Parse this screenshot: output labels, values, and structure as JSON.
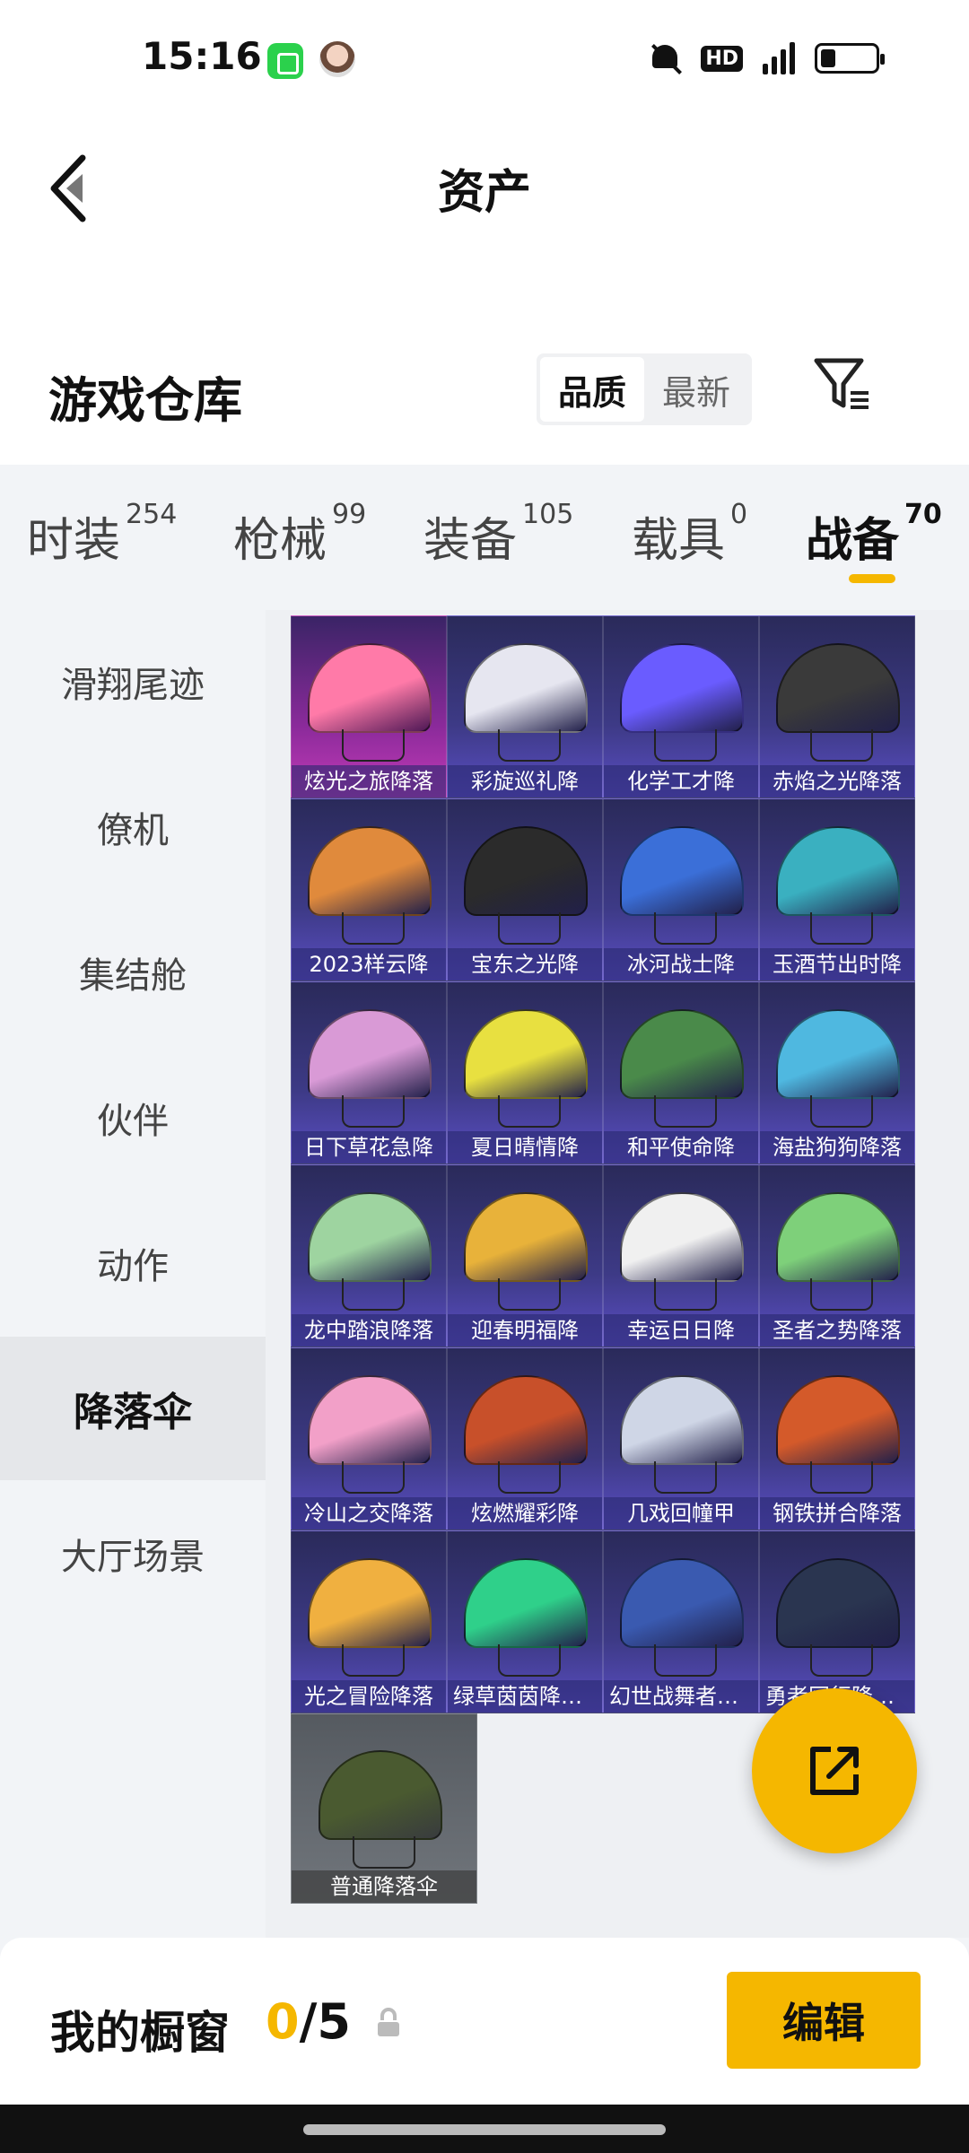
{
  "status": {
    "time": "15:16"
  },
  "nav": {
    "title": "资产"
  },
  "warehouse": {
    "title": "游戏仓库",
    "sort_options": [
      {
        "label": "品质",
        "active": true
      },
      {
        "label": "最新",
        "active": false
      }
    ]
  },
  "category_tabs": [
    {
      "label": "时装",
      "count": "254"
    },
    {
      "label": "枪械",
      "count": "99"
    },
    {
      "label": "装备",
      "count": "105"
    },
    {
      "label": "载具",
      "count": "0"
    },
    {
      "label": "战备",
      "count": "70",
      "active": true
    }
  ],
  "sidebar": [
    {
      "label": "滑翔尾迹"
    },
    {
      "label": "僚机"
    },
    {
      "label": "集结舱"
    },
    {
      "label": "伙伴"
    },
    {
      "label": "动作"
    },
    {
      "label": "降落伞",
      "active": true
    },
    {
      "label": "大厅场景"
    }
  ],
  "items": [
    {
      "name": "炫光之旅降落",
      "color": "#ff7aa8"
    },
    {
      "name": "彩旋巡礼降",
      "color": "#e6e6f0"
    },
    {
      "name": "化学工才降",
      "color": "#6a5cff"
    },
    {
      "name": "赤焰之光降落",
      "color": "#3a3a3a"
    },
    {
      "name": "2023样云降",
      "color": "#e08a3c"
    },
    {
      "name": "宝东之光降",
      "color": "#2b2b2b"
    },
    {
      "name": "冰河战士降",
      "color": "#3b6fd8"
    },
    {
      "name": "玉酒节出时降",
      "color": "#3ab0c0"
    },
    {
      "name": "日下草花急降",
      "color": "#d99ad6"
    },
    {
      "name": "夏日晴情降",
      "color": "#e8e040"
    },
    {
      "name": "和平使命降",
      "color": "#4a8a4a"
    },
    {
      "name": "海盐狗狗降落",
      "color": "#4fb8e0"
    },
    {
      "name": "龙中踏浪降落",
      "color": "#9ed4a0"
    },
    {
      "name": "迎春明福降",
      "color": "#e8b23a"
    },
    {
      "name": "幸运日日降",
      "color": "#f0f0f0"
    },
    {
      "name": "圣者之势降落",
      "color": "#7ed07a"
    },
    {
      "name": "冷山之交降落",
      "color": "#f2a0c8"
    },
    {
      "name": "炫燃耀彩降",
      "color": "#c8502a"
    },
    {
      "name": "几戏回幢甲",
      "color": "#cfd6e6"
    },
    {
      "name": "钢铁拼合降落",
      "color": "#d45a2a"
    },
    {
      "name": "光之冒险降落",
      "color": "#f0b040"
    },
    {
      "name": "绿草茵茵降落伞",
      "color": "#2fd08a"
    },
    {
      "name": "幻世战舞者降落伞",
      "color": "#3a5ab0"
    },
    {
      "name": "勇者同行降落伞",
      "color": "#2a3550"
    },
    {
      "name": "普通降落伞",
      "color": "#4a5a30",
      "common": true
    }
  ],
  "showcase": {
    "label": "我的橱窗",
    "current": "0",
    "sep": "/",
    "total": "5",
    "edit_label": "编辑"
  },
  "icons": {
    "back": "chevron-left-icon",
    "filter": "filter-icon",
    "share": "share-icon",
    "lock": "lock-icon"
  },
  "accent": "#f5b700"
}
